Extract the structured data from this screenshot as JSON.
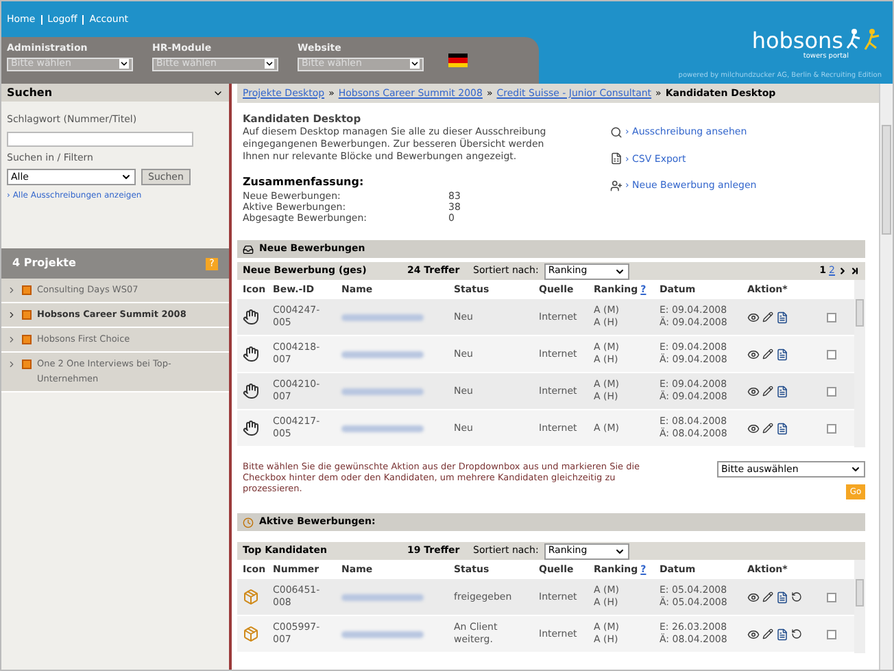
{
  "top_links": [
    "Home",
    "Logoff",
    "Account"
  ],
  "header_selects": [
    {
      "label": "Administration",
      "placeholder": "Bitte wählen"
    },
    {
      "label": "HR-Module",
      "placeholder": "Bitte wählen"
    },
    {
      "label": "Website",
      "placeholder": "Bitte wählen"
    }
  ],
  "logo": {
    "name": "hobsons",
    "tagline": "towers portal",
    "powered": "powered by milchundzucker AG, Berlin & Recruiting Edition"
  },
  "search": {
    "title": "Suchen",
    "keyword_label": "Schlagwort (Nummer/Titel)",
    "filter_label": "Suchen in / Filtern",
    "filter_value": "Alle",
    "button": "Suchen",
    "link_marker": "›",
    "link": "Alle Ausschreibungen anzeigen"
  },
  "projects": {
    "title": "4 Projekte",
    "help": "?",
    "items": [
      {
        "label": "Consulting Days WS07",
        "selected": false
      },
      {
        "label": "Hobsons Career Summit 2008",
        "selected": true
      },
      {
        "label": "Hobsons First Choice",
        "selected": false
      },
      {
        "label": "One 2 One Interviews bei Top-Unternehmen",
        "selected": false
      }
    ]
  },
  "breadcrumb": [
    {
      "label": "Projekte Desktop",
      "current": false
    },
    {
      "separator": "»",
      "label": "Hobsons Career Summit 2008",
      "current": false
    },
    {
      "separator": "»",
      "label": "Credit Suisse - Junior Consultant",
      "current": false
    },
    {
      "separator": "»",
      "label": "Kandidaten Desktop",
      "current": true
    }
  ],
  "intro": {
    "title": "Kandidaten Desktop",
    "text": "Auf diesem Desktop managen Sie alle zu dieser Ausschreibung eingegangenen Bewerbungen. Zur besseren Übersicht werden Ihnen nur relevante Blöcke und Bewerbungen angezeigt.",
    "summary_title": "Zusammenfassung:",
    "summary": [
      {
        "label": "Neue Bewerbungen:",
        "value": "83"
      },
      {
        "label": "Aktive Bewerbungen:",
        "value": "38"
      },
      {
        "label": "Abgesagte Bewerbungen:",
        "value": "0"
      }
    ]
  },
  "actions": [
    {
      "kind": "view",
      "marker": "›",
      "label": "Ausschreibung ansehen"
    },
    {
      "kind": "export",
      "marker": "›",
      "label": "CSV Export"
    },
    {
      "kind": "new",
      "marker": "›",
      "label": "Neue Bewerbung anlegen"
    }
  ],
  "new_section": {
    "title": "Neue Bewerbungen",
    "subtitle": "Neue Bewerbung (ges)",
    "hits": "24 Treffer",
    "sort_label": "Sortiert nach:",
    "sort_value": "Ranking",
    "pages": [
      {
        "label": "1",
        "selected": true
      },
      {
        "label": "2",
        "selected": false
      }
    ],
    "columns": [
      "Icon",
      "Bew.-ID",
      "Name",
      "Status",
      "Quelle",
      "Ranking",
      "?",
      "Datum",
      "Aktion*"
    ],
    "rows": [
      {
        "id": "C004247-005",
        "status": "Neu",
        "source": "Internet",
        "ranking": [
          "A (M)",
          "A (H)"
        ],
        "dates": [
          "E: 09.04.2008",
          "Ä: 09.04.2008"
        ],
        "checked": false
      },
      {
        "id": "C004218-007",
        "status": "Neu",
        "source": "Internet",
        "ranking": [
          "A (M)",
          "A (H)"
        ],
        "dates": [
          "E: 09.04.2008",
          "Ä: 09.04.2008"
        ],
        "checked": false
      },
      {
        "id": "C004210-007",
        "status": "Neu",
        "source": "Internet",
        "ranking": [
          "A (M)",
          "A (H)"
        ],
        "dates": [
          "E: 09.04.2008",
          "Ä: 09.04.2008"
        ],
        "checked": false
      },
      {
        "id": "C004217-005",
        "status": "Neu",
        "source": "Internet",
        "ranking": [
          "A (M)"
        ],
        "dates": [
          "E: 08.04.2008",
          "Ä: 08.04.2008"
        ],
        "checked": false
      }
    ]
  },
  "bulk": {
    "text": "Bitte wählen Sie die gewünschte Aktion aus der Dropdownbox aus und markieren Sie die Checkbox hinter dem oder den Kandidaten, um mehrere Kandidaten gleichzeitig zu prozessieren.",
    "select": "Bitte auswählen",
    "button": "Go"
  },
  "active_section": {
    "title": "Aktive Bewerbungen:",
    "subtitle": "Top Kandidaten",
    "hits": "19 Treffer",
    "sort_label": "Sortiert nach:",
    "sort_value": "Ranking",
    "columns": [
      "Icon",
      "Nummer",
      "Name",
      "Status",
      "Quelle",
      "Ranking",
      "?",
      "Datum",
      "Aktion*"
    ],
    "rows": [
      {
        "id": "C006451-008",
        "status": "freigegeben",
        "source": "Internet",
        "ranking": [
          "A (M)",
          "A (H)"
        ],
        "dates": [
          "E: 05.04.2008",
          "Ä: 05.04.2008"
        ],
        "checked": false
      },
      {
        "id": "C005997-007",
        "status": "An Client weiterg.",
        "source": "Internet",
        "ranking": [
          "A (M)",
          "A (H)"
        ],
        "dates": [
          "E: 26.03.2008",
          "Ä: 08.04.2008"
        ],
        "checked": false
      }
    ]
  }
}
